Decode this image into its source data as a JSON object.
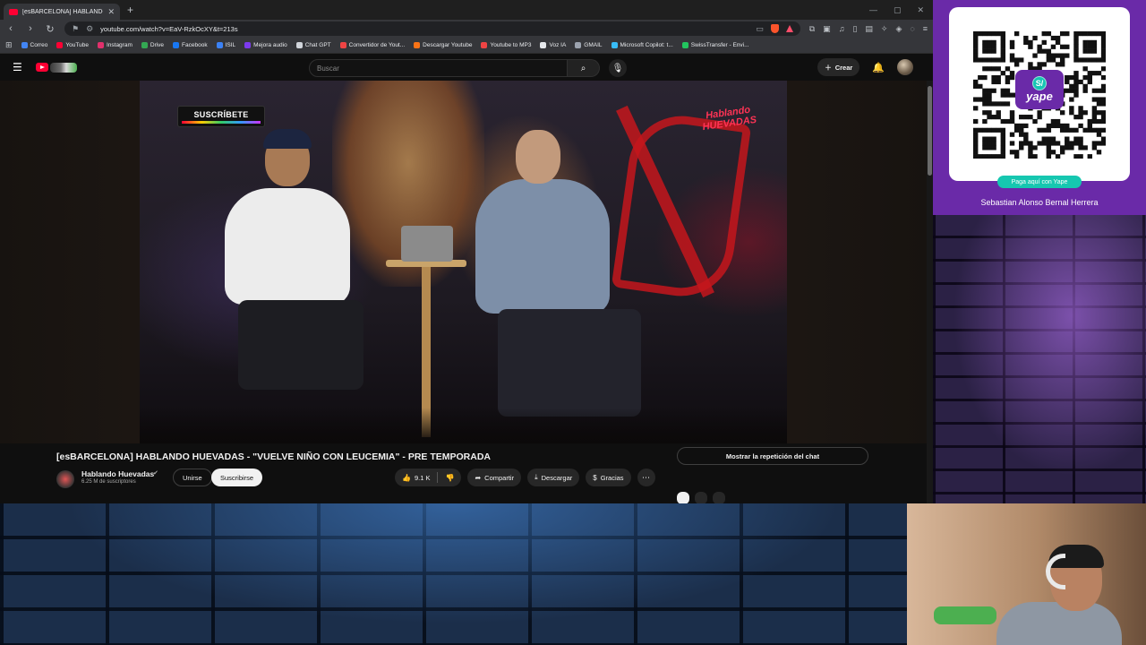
{
  "browser": {
    "tab_title": "[esBARCELONA] HABLANDO HUEVADAS",
    "url": "youtube.com/watch?v=EaV-RzkOcXY&t=213s",
    "bookmarks": [
      {
        "label": "Correo",
        "color": "#4285f4"
      },
      {
        "label": "YouTube",
        "color": "#ff0033"
      },
      {
        "label": "Instagram",
        "color": "#e1306c"
      },
      {
        "label": "Drive",
        "color": "#34a853"
      },
      {
        "label": "Facebook",
        "color": "#1877f2"
      },
      {
        "label": "ISIL",
        "color": "#3b82f6"
      },
      {
        "label": "Mejora audio",
        "color": "#7c3aed"
      },
      {
        "label": "Chat GPT",
        "color": "#d1d5db"
      },
      {
        "label": "Convertidor de Yout...",
        "color": "#ef4444"
      },
      {
        "label": "Descargar Youtube",
        "color": "#f97316"
      },
      {
        "label": "Youtube to MP3",
        "color": "#ef4444"
      },
      {
        "label": "Voz IA",
        "color": "#e5e7eb"
      },
      {
        "label": "GMAIL",
        "color": "#9ca3af"
      },
      {
        "label": "Microsoft Copilot: t...",
        "color": "#38bdf8"
      },
      {
        "label": "SwissTransfer - Envi...",
        "color": "#22c55e"
      }
    ]
  },
  "youtube": {
    "search_placeholder": "Buscar",
    "create_label": "Crear"
  },
  "video": {
    "overlay_subscribe": "SUSCRÍBETE",
    "brand_line1": "Hablando",
    "brand_line2": "HUEVADAS",
    "title": "[esBARCELONA] HABLANDO HUEVADAS - \"VUELVE NIÑO CON LEUCEMIA\" - PRE TEMPORADA"
  },
  "channel": {
    "name": "Hablando Huevadas",
    "subscribers": "6.25 M de suscriptores",
    "join_label": "Unirse",
    "subscribe_label": "Suscribirse"
  },
  "actions": {
    "likes": "9.1 K",
    "share_label": "Compartir",
    "download_label": "Descargar",
    "thanks_label": "Gracias"
  },
  "chat_replay_label": "Mostrar la repetición del chat",
  "qr": {
    "currency_symbol": "S/",
    "brand": "yape",
    "pay_label": "Paga aquí con Yape",
    "payee": "Sebastian Alonso Bernal Herrera"
  },
  "colors": {
    "yt_red": "#ff0033",
    "yape_purple": "#6a2aa8",
    "yape_teal": "#16c7b0"
  }
}
